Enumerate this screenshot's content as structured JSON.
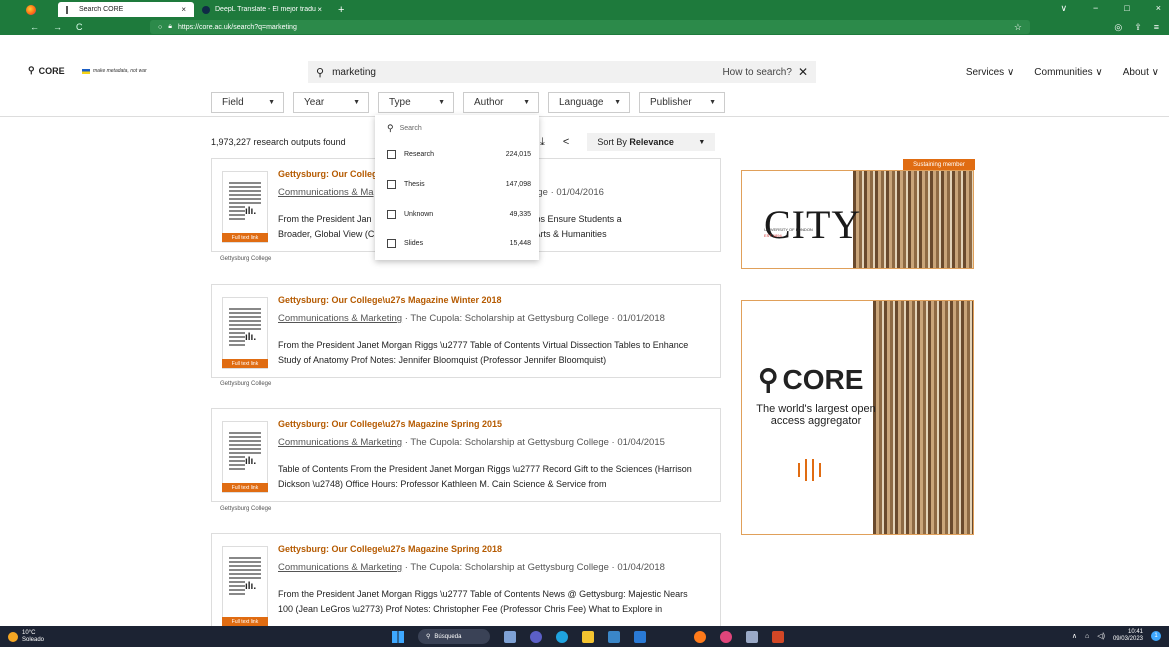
{
  "browser": {
    "tabs": [
      {
        "title": "Search CORE",
        "active": true
      },
      {
        "title": "DeepL Translate - El mejor tradu",
        "active": false
      }
    ],
    "new_tab": "+",
    "url": "https://core.ac.uk/search?q=marketing",
    "controls": {
      "back": "←",
      "forward": "→",
      "reload": "C",
      "minimize": "−",
      "maximize": "□",
      "close": "×",
      "menu_chevron": "∨"
    }
  },
  "site": {
    "logo_text": "CORE",
    "tagline": "make metadata, not war",
    "search_query": "marketing",
    "how_to_search": "How to search?",
    "nav": [
      "Services",
      "Communities",
      "About"
    ],
    "filters": [
      "Field",
      "Year",
      "Type",
      "Author",
      "Language",
      "Publisher"
    ]
  },
  "results": {
    "count_text": "1,973,227 research outputs found",
    "sort_label": "Sort By",
    "sort_value": "Relevance",
    "badge": "Full text link",
    "items": [
      {
        "title": "Gettysburg: Our Colleg",
        "meta_link": "Communications & Ma",
        "meta_rest": "ettysburg College · 01/04/2016",
        "abstract_1": "From the President Jan",
        "abstract_1b": "ents Scholarships Ensure Students a",
        "abstract_2": "Broader, Global View (C",
        "abstract_2b": "st and Dean of Arts & Humanities",
        "provider": "Gettysburg College"
      },
      {
        "title": "Gettysburg: Our College\\u27s Magazine Winter 2018",
        "meta_link": "Communications & Marketing",
        "meta_rest": " · The Cupola: Scholarship at Gettysburg College · 01/01/2018",
        "abstract": "From the President Janet Morgan Riggs \\u2777 Table of Contents Virtual Dissection Tables to Enhance Study of Anatomy Prof Notes: Jennifer Bloomquist (Professor Jennifer Bloomquist)",
        "provider": "Gettysburg College"
      },
      {
        "title": "Gettysburg: Our College\\u27s Magazine Spring 2015",
        "meta_link": "Communications & Marketing",
        "meta_rest": " · The Cupola: Scholarship at Gettysburg College · 01/04/2015",
        "abstract": "Table of Contents From the President Janet Morgan Riggs \\u2777 Record Gift to the Sciences (Harrison Dickson \\u2748) Office Hours: Professor Kathleen M. Cain Science & Service from",
        "provider": "Gettysburg College"
      },
      {
        "title": "Gettysburg: Our College\\u27s Magazine Spring 2018",
        "meta_link": "Communications & Marketing",
        "meta_rest": " · The Cupola: Scholarship at Gettysburg College · 01/04/2018",
        "abstract": "From the President Janet Morgan Riggs \\u2777 Table of Contents News @ Gettysburg: Majestic Nears 100 (Jean LeGros \\u2773) Prof Notes: Christopher Fee (Professor Chris Fee) What to Explore in"
      }
    ]
  },
  "type_dropdown": {
    "search_placeholder": "Search",
    "options": [
      {
        "label": "Research",
        "count": "224,015"
      },
      {
        "label": "Thesis",
        "count": "147,098"
      },
      {
        "label": "Unknown",
        "count": "49,335"
      },
      {
        "label": "Slides",
        "count": "15,448"
      }
    ]
  },
  "ads": {
    "sustaining_label": "Sustaining member",
    "city_name": "CITY",
    "city_sub": "UNIVERSITY OF LONDON",
    "city_est": "EST 1894",
    "core_name": "CORE",
    "core_text": "The world's largest open access aggregator"
  },
  "taskbar": {
    "temp": "10°C",
    "weather": "Soleado",
    "search": "Búsqueda",
    "time": "10:41",
    "date": "09/03/2023",
    "notifications": "1"
  },
  "colors": {
    "browser_green": "#1e7a3c",
    "accent_orange": "#e06c12",
    "title_orange": "#b55a00"
  }
}
